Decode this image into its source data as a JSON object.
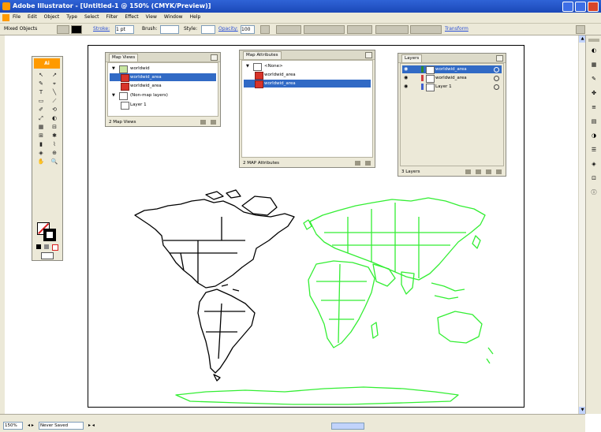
{
  "window": {
    "title": "Adobe Illustrator - [Untitled-1 @ 150% (CMYK/Preview)]"
  },
  "menu": [
    "File",
    "Edit",
    "Object",
    "Type",
    "Select",
    "Filter",
    "Effect",
    "View",
    "Window",
    "Help"
  ],
  "control_bar": {
    "selection_label": "Mixed Objects",
    "stroke_label": "Stroke:",
    "stroke_value": "1 pt",
    "brush_label": "Brush:",
    "style_label": "Style:",
    "opacity_label": "Opacity:",
    "opacity_value": "100",
    "transform_link": "Transform"
  },
  "toolbox": {
    "logo": "Ai",
    "tools": [
      "↖",
      "↗",
      "✎",
      "⌖",
      "T",
      "╲",
      "▭",
      "⟋",
      "✐",
      "⟲",
      "⤢",
      "◐",
      "▦",
      "⊟",
      "⊞",
      "✱",
      "▮",
      "⌇",
      "◈",
      "⊕",
      "✋",
      "🔍"
    ]
  },
  "panels": {
    "map_views": {
      "tab": "Map Views",
      "rows": [
        {
          "label": "worldwid",
          "selected": false
        },
        {
          "label": "worldwid_area",
          "selected": true
        },
        {
          "label": "worldwid_area",
          "selected": false
        },
        {
          "label": "(Non-map layers)",
          "selected": false
        },
        {
          "label": "Layer 1",
          "selected": false
        }
      ],
      "footer": "2 Map Views"
    },
    "map_attributes": {
      "tab": "Map Attributes",
      "rows": [
        {
          "label": "<None>",
          "selected": false
        },
        {
          "label": "worldwid_area",
          "selected": false
        },
        {
          "label": "worldwid_area",
          "selected": true
        }
      ],
      "footer": "2 MAP Attributes"
    },
    "layers": {
      "tab": "Layers",
      "rows": [
        {
          "label": "worldwid_area",
          "selected": true,
          "swatch": "#2d8a2d"
        },
        {
          "label": "worldwid_area",
          "selected": false,
          "swatch": "#d04040"
        },
        {
          "label": "Layer 1",
          "selected": false,
          "swatch": "#4060d0"
        }
      ],
      "footer": "3 Layers"
    }
  },
  "status_bar": {
    "zoom": "150%",
    "status_text": "Never Saved"
  },
  "map": {
    "west_color": "#000000",
    "east_color": "#33ee33"
  }
}
